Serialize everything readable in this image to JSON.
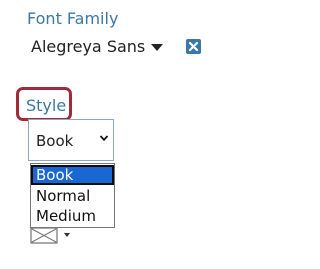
{
  "font_family": {
    "label": "Font Family",
    "selected": "Alegreya Sans"
  },
  "style": {
    "label": "Style",
    "selected": "Book",
    "options": [
      "Book",
      "Normal",
      "Medium"
    ]
  },
  "colors": {
    "accent": "#3b78a5",
    "highlight_border": "#a12b3b",
    "option_selected_bg": "#1967d2"
  }
}
